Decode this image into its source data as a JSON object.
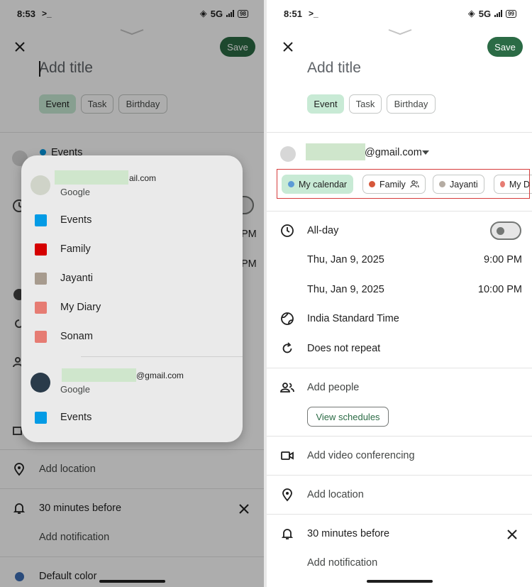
{
  "left": {
    "status": {
      "time": "8:53",
      "network": "5G",
      "battery": "98"
    },
    "save_label": "Save",
    "title_placeholder": "Add title",
    "chips": [
      {
        "label": "Event"
      },
      {
        "label": "Task"
      },
      {
        "label": "Birthday"
      }
    ],
    "bg_calendar_label": "Events",
    "bg_time_fragments": [
      "PM",
      "PM"
    ],
    "location_label": "Add location",
    "notification_label": "30 minutes before",
    "add_notification_label": "Add notification",
    "default_color_label": "Default color",
    "menu": {
      "account1": {
        "email_suffix": "ail.com",
        "provider": "Google"
      },
      "calendars1": [
        {
          "label": "Events",
          "color": "#039be5"
        },
        {
          "label": "Family",
          "color": "#d50000"
        },
        {
          "label": "Jayanti",
          "color": "#a79b8e"
        },
        {
          "label": "My Diary",
          "color": "#e67c73"
        },
        {
          "label": "Sonam",
          "color": "#e67c73"
        }
      ],
      "account2": {
        "email_suffix": "@gmail.com",
        "provider": "Google"
      },
      "calendars2": [
        {
          "label": "Events",
          "color": "#039be5"
        }
      ]
    }
  },
  "right": {
    "status": {
      "time": "8:51",
      "network": "5G",
      "battery": "99"
    },
    "save_label": "Save",
    "title_placeholder": "Add title",
    "chips": [
      {
        "label": "Event"
      },
      {
        "label": "Task"
      },
      {
        "label": "Birthday"
      }
    ],
    "account_email_suffix": "@gmail.com",
    "calendar_chips": [
      {
        "label": "My calendar",
        "color": "#5c9bd6"
      },
      {
        "label": "Family",
        "color": "#d6573b"
      },
      {
        "label": "Jayanti",
        "color": "#b5aca3"
      },
      {
        "label": "My D",
        "color": "#e67c73"
      }
    ],
    "all_day_label": "All-day",
    "start": {
      "date": "Thu, Jan 9, 2025",
      "time": "9:00 PM"
    },
    "end": {
      "date": "Thu, Jan 9, 2025",
      "time": "10:00 PM"
    },
    "timezone_label": "India Standard Time",
    "repeat_label": "Does not repeat",
    "add_people_label": "Add people",
    "view_schedules_label": "View schedules",
    "video_label": "Add video conferencing",
    "location_label": "Add location",
    "notification_label": "30 minutes before",
    "add_notification_label": "Add notification"
  },
  "colors": {
    "accent": "#2b6b45",
    "chip_active": "#c8ead5",
    "highlight": "#d63b3b"
  }
}
